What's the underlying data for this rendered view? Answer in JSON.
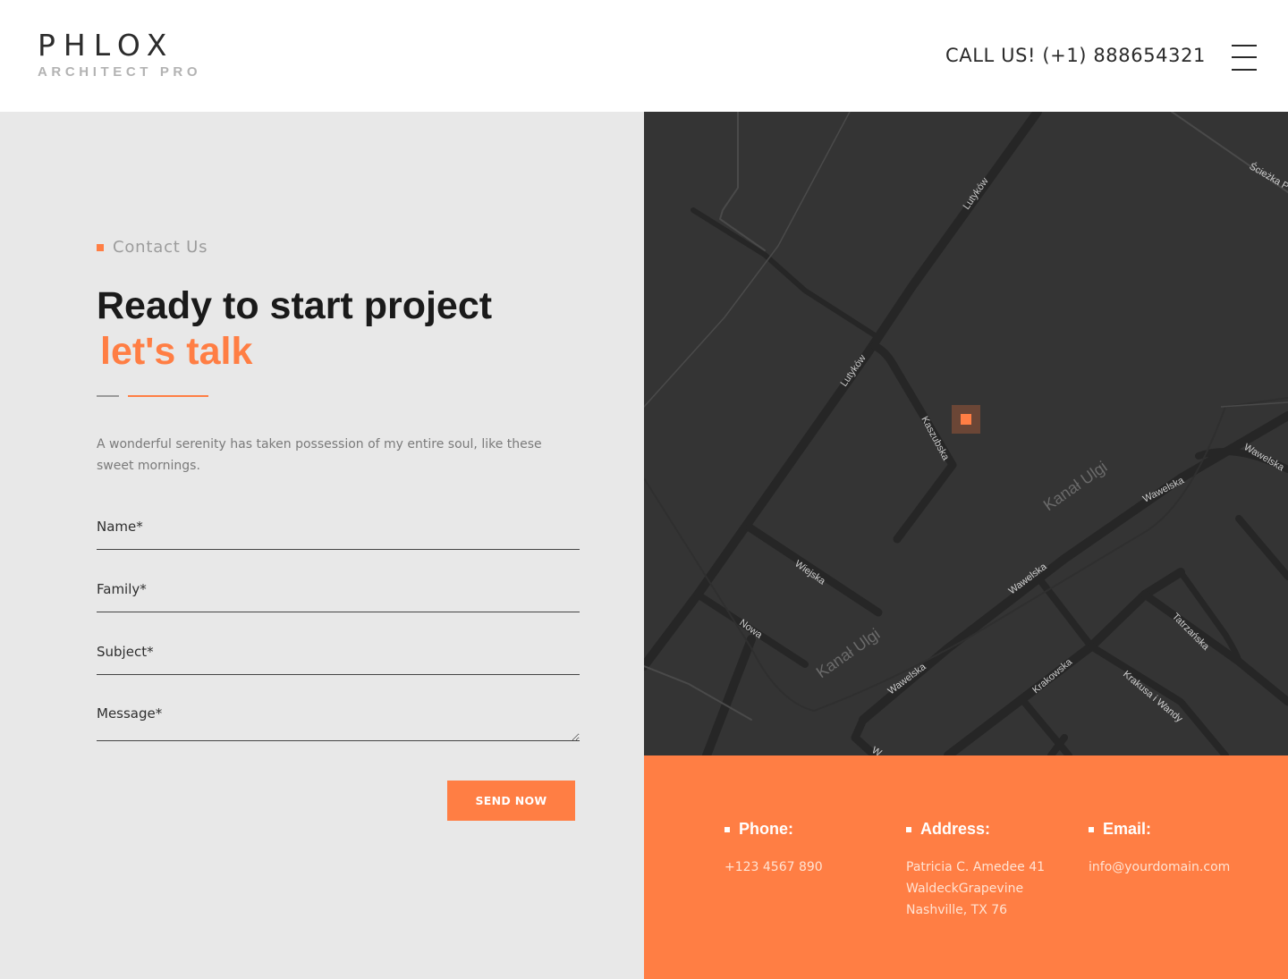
{
  "header": {
    "logo_main": "PHLOX",
    "logo_sub": "ARCHITECT PRO",
    "call": "CALL US! (+1) 888654321",
    "menu_icon": "hamburger-menu-icon"
  },
  "contact": {
    "eyebrow": "Contact Us",
    "title_line1": "Ready to start project",
    "title_line2": "let's talk",
    "intro": "A wonderful serenity has taken possession of my entire soul, like these sweet mornings.",
    "fields": {
      "name_placeholder": "Name*",
      "family_placeholder": "Family*",
      "subject_placeholder": "Subject*",
      "message_placeholder": "Message*"
    },
    "send_label": "SEND NOW"
  },
  "map": {
    "streets": {
      "lutykow_top": "Lutyków",
      "lutykow_mid": "Lutyków",
      "kaszubska": "Kaszubska",
      "wiejska": "Wiejska",
      "nowa": "Nowa",
      "wawelska_1": "Wawelska",
      "wawelska_2": "Wawelska",
      "wawelska_3": "Wawelska",
      "wawelska_4": "Wawelska",
      "krakowska": "Krakowska",
      "tatrzanska": "Tatrzańska",
      "krakusa": "Krakusa i Wandy",
      "sciezka": "Ścieżka P",
      "w_bottom": "W"
    },
    "water": {
      "canal_1": "Kanał Ulgi",
      "canal_2": "Kanał Ulgi"
    },
    "marker_icon": "map-marker-icon"
  },
  "info": {
    "phone_label": "Phone:",
    "phone_value": "+123 4567 890",
    "address_label": "Address:",
    "address_lines": [
      "Patricia C. Amedee 41",
      "WaldeckGrapevine",
      "Nashville, TX 76"
    ],
    "email_label": "Email:",
    "email_value": "info@yourdomain.com"
  },
  "colors": {
    "accent": "#ff7e44",
    "panel": "#e8e8e8",
    "map_bg": "#343434",
    "text_dark": "#1a1a1a"
  }
}
